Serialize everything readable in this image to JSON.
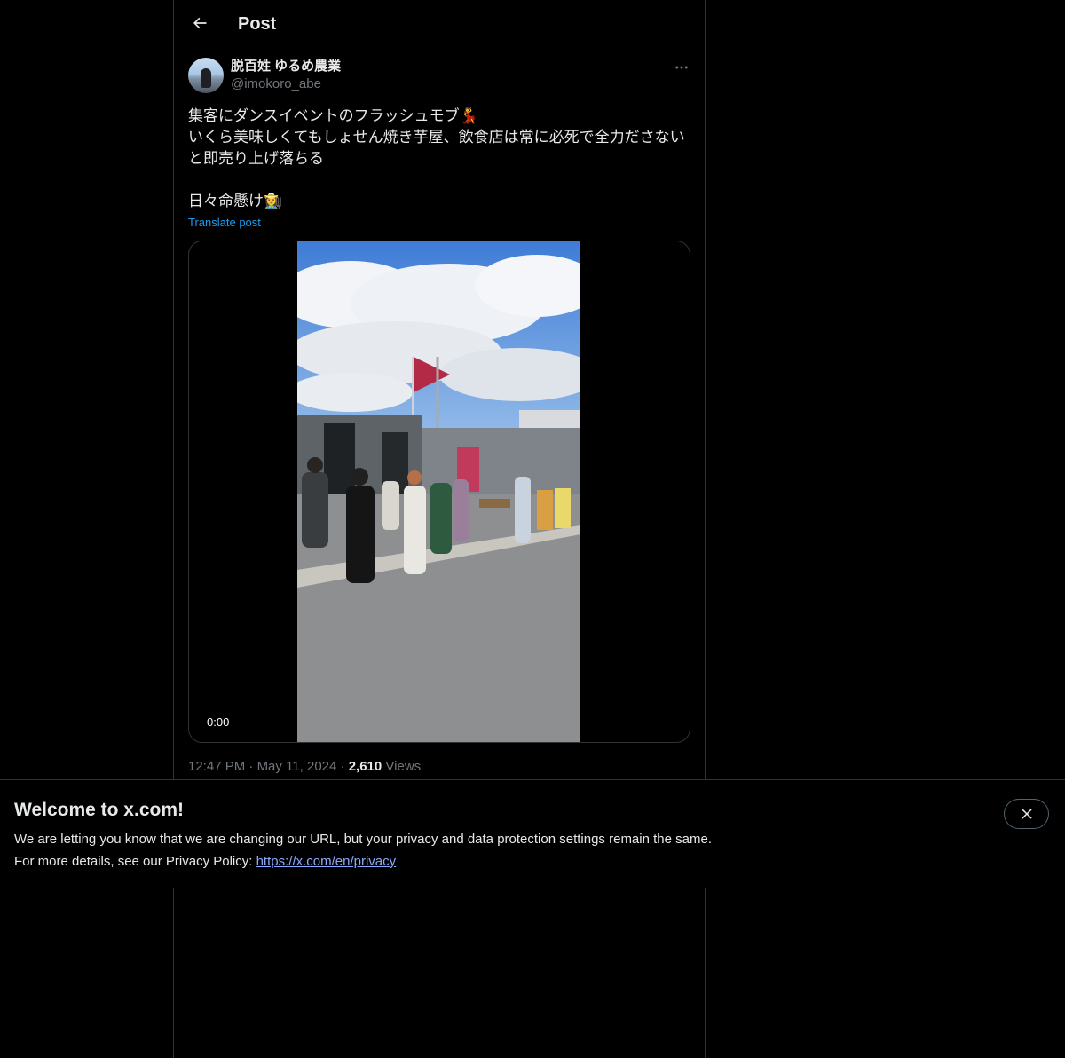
{
  "colors": {
    "background": "#000000",
    "text": "#e7e9ea",
    "muted": "#71767b",
    "accent": "#1d9bf0",
    "border": "#2f3336"
  },
  "header": {
    "back_icon": "arrow-left-icon",
    "title": "Post"
  },
  "post": {
    "author": {
      "display_name": "脱百姓 ゆるめ農業",
      "handle": "@imokoro_abe",
      "avatar_icon": "avatar-photo"
    },
    "more_icon": "more-horizontal-icon",
    "text": "集客にダンスイベントのフラッシュモブ💃\nいくら美味しくてもしょせん焼き芋屋、飲食店は常に必死で全力ださないと即売り上げ落ちる\n\n日々命懸け👩‍🌾",
    "translate_label": "Translate post",
    "media": {
      "type": "video",
      "time": "0:00"
    },
    "time": "12:47 PM",
    "separator": "·",
    "date": "May 11, 2024",
    "views_count": "2,610",
    "views_label": "Views"
  },
  "banner": {
    "title": "Welcome to x.com!",
    "line1": "We are letting you know that we are changing our URL, but your privacy and data protection settings remain the same.",
    "line2_prefix": "For more details, see our Privacy Policy: ",
    "link": "https://x.com/en/privacy",
    "close_icon": "close-icon"
  }
}
